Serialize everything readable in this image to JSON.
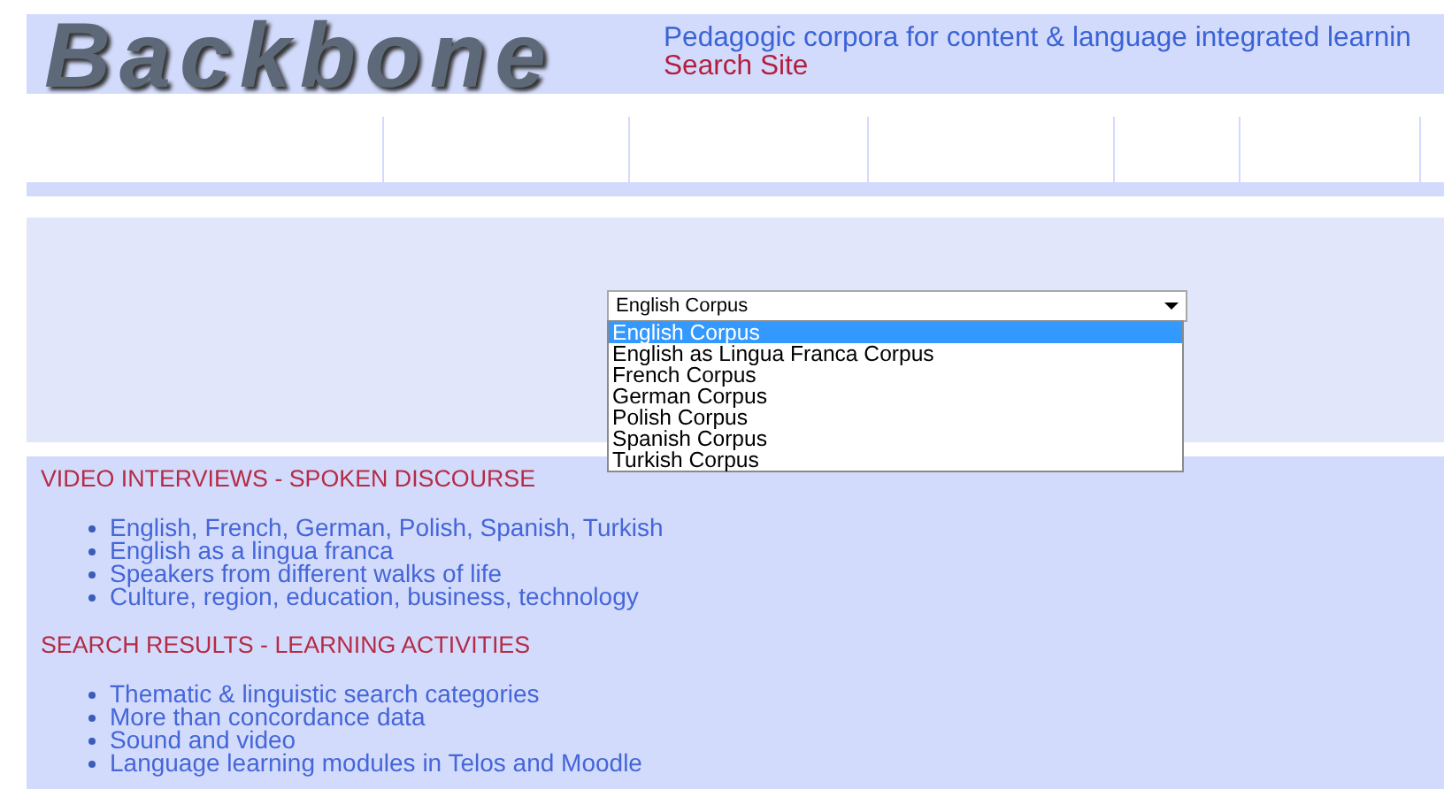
{
  "header": {
    "logo": "Backbone",
    "tagline": "Pedagogic corpora for content & language integrated learnin",
    "search_link": "Search Site"
  },
  "corpus_select": {
    "value": "English Corpus",
    "expanded": true,
    "options": [
      {
        "label": "English Corpus",
        "selected": true
      },
      {
        "label": "English as Lingua Franca Corpus",
        "selected": false
      },
      {
        "label": "French Corpus",
        "selected": false
      },
      {
        "label": "German Corpus",
        "selected": false
      },
      {
        "label": "Polish Corpus",
        "selected": false
      },
      {
        "label": "Spanish Corpus",
        "selected": false
      },
      {
        "label": "Turkish Corpus",
        "selected": false
      }
    ]
  },
  "sections": [
    {
      "heading": "VIDEO INTERVIEWS - SPOKEN DISCOURSE",
      "items": [
        "English, French, German, Polish, Spanish, Turkish",
        "English as a lingua franca",
        "Speakers from different walks of life",
        "Culture, region, education, business, technology"
      ]
    },
    {
      "heading": "SEARCH RESULTS - LEARNING ACTIVITIES",
      "items": [
        "Thematic & linguistic search categories",
        "More than concordance data",
        "Sound and video",
        "Language learning modules in Telos and Moodle"
      ]
    }
  ]
}
